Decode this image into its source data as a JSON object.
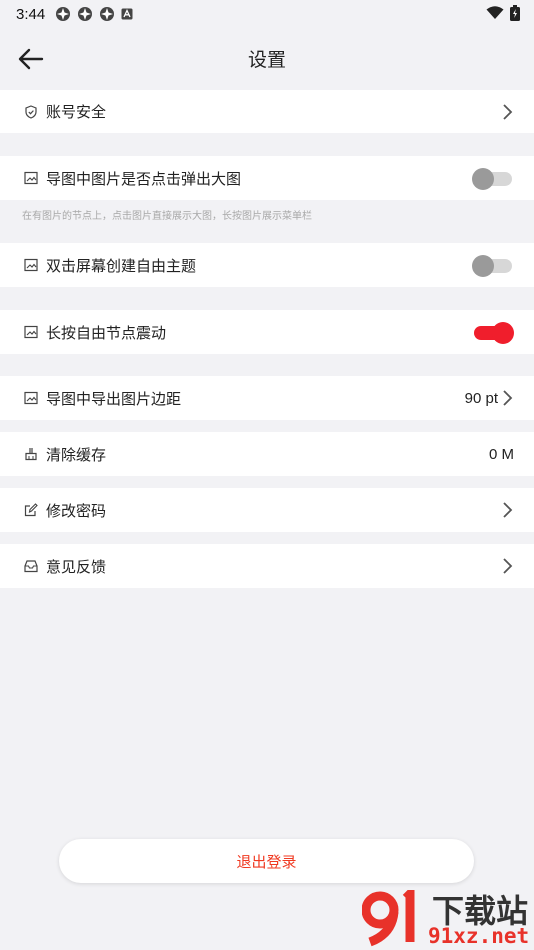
{
  "status_bar": {
    "time": "3:44",
    "icons": [
      "app-notification-icon",
      "app-notification-icon",
      "app-notification-icon",
      "a-notification-icon"
    ],
    "right_icons": [
      "wifi-icon",
      "battery-icon"
    ]
  },
  "header": {
    "title": "设置"
  },
  "rows": {
    "account": {
      "label": "账号安全",
      "icon": "shield-icon"
    },
    "popup_image": {
      "label": "导图中图片是否点击弹出大图",
      "icon": "image-icon",
      "enabled": false
    },
    "popup_hint": "在有图片的节点上，点击图片直接展示大图，长按图片展示菜单栏",
    "double_click": {
      "label": "双击屏幕创建自由主题",
      "icon": "image-icon",
      "enabled": false
    },
    "long_press": {
      "label": "长按自由节点震动",
      "icon": "image-icon",
      "enabled": true
    },
    "export_margin": {
      "label": "导图中导出图片边距",
      "icon": "image-icon",
      "value": "90 pt"
    },
    "clear_cache": {
      "label": "清除缓存",
      "icon": "broom-icon",
      "value": "0 M"
    },
    "change_password": {
      "label": "修改密码",
      "icon": "edit-icon"
    },
    "feedback": {
      "label": "意见反馈",
      "icon": "inbox-icon"
    }
  },
  "logout_label": "退出登录",
  "watermark": {
    "line1": "下载站",
    "line2": "91xz.net"
  },
  "colors": {
    "accent": "#f01e2c",
    "logout_text": "#f03a22",
    "background": "#f2f2f5"
  }
}
